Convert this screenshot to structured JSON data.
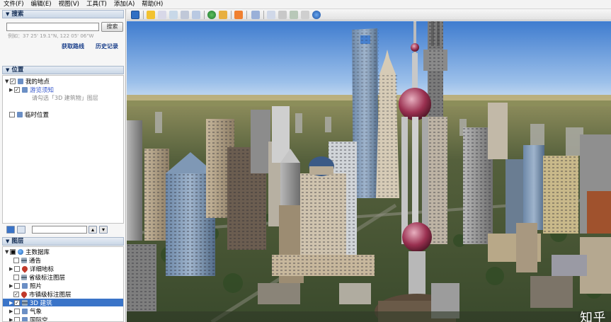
{
  "menu": [
    "文件(F)",
    "编辑(E)",
    "视图(V)",
    "工具(T)",
    "添加(A)",
    "帮助(H)"
  ],
  "search": {
    "title": "搜索",
    "button": "搜索",
    "hint": "例如：37 25' 19.1\"N, 122 05' 06\"W",
    "route_link": "获取路线",
    "history_link": "历史记录"
  },
  "places": {
    "title": "位置",
    "items": [
      "我的地点",
      "游览须知",
      "请勾选「3D 建筑物」图层",
      "临时位置"
    ]
  },
  "layers": {
    "title": "图层",
    "items": [
      "主数据库",
      "通告",
      "详细地标",
      "省级标注图层",
      "照片",
      "市镇级标注图层",
      "3D 建筑",
      "气象",
      "国际空"
    ]
  },
  "watermark": "知乎 @GIS小巫师",
  "colors": {
    "sky_top": "#3f7ccf",
    "sky_horizon": "#b7d2ee",
    "selection": "#3a74c8",
    "panel_header": "#c9d6e6"
  }
}
